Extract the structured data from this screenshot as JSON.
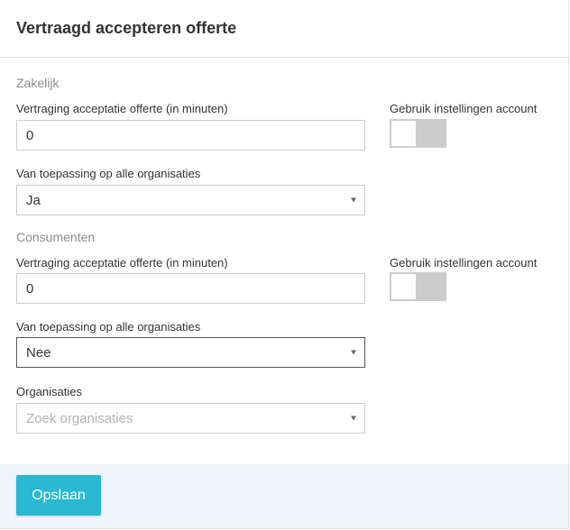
{
  "title": "Vertraagd accepteren offerte",
  "business": {
    "section_title": "Zakelijk",
    "delay_label": "Vertraging acceptatie offerte (in minuten)",
    "delay_value": "0",
    "use_account_label": "Gebruik instellingen account",
    "use_account_on": false,
    "applies_label": "Van toepassing op alle organisaties",
    "applies_value": "Ja"
  },
  "consumers": {
    "section_title": "Consumenten",
    "delay_label": "Vertraging acceptatie offerte (in minuten)",
    "delay_value": "0",
    "use_account_label": "Gebruik instellingen account",
    "use_account_on": false,
    "applies_label": "Van toepassing op alle organisaties",
    "applies_value": "Nee",
    "organisations_label": "Organisaties",
    "organisations_placeholder": "Zoek organisaties"
  },
  "footer": {
    "save_label": "Opslaan"
  },
  "colors": {
    "accent": "#29b9d3",
    "footer_bg": "#eef6fb",
    "toggle_off": "#cccccc"
  },
  "icons": {
    "select_caret": "caret-down-icon"
  }
}
